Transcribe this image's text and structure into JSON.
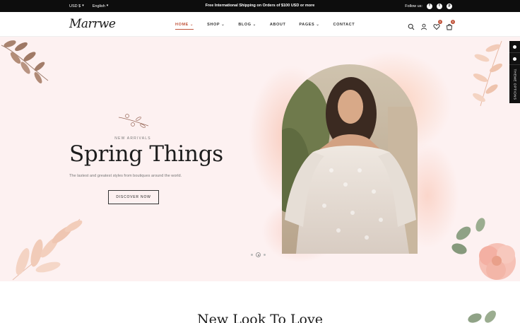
{
  "topbar": {
    "currency": "USD $",
    "language": "English",
    "promo": "Free International Shipping on Orders of $100 USD or more",
    "follow_label": "Follow us:",
    "social": [
      {
        "icon": "facebook-icon",
        "glyph": "f"
      },
      {
        "icon": "twitter-icon",
        "glyph": "t"
      },
      {
        "icon": "pinterest-icon",
        "glyph": "p"
      }
    ]
  },
  "header": {
    "logo": "Marrwe",
    "nav": [
      {
        "label": "HOME",
        "has_dropdown": true,
        "active": true
      },
      {
        "label": "SHOP",
        "has_dropdown": true
      },
      {
        "label": "BLOG",
        "has_dropdown": true
      },
      {
        "label": "ABOUT",
        "has_dropdown": false
      },
      {
        "label": "PAGES",
        "has_dropdown": true
      },
      {
        "label": "CONTACT",
        "has_dropdown": false
      }
    ],
    "wishlist_count": "0",
    "cart_count": "0",
    "accent": "#c0533a"
  },
  "hero": {
    "subtitle": "NEW ARRIVALS",
    "title": "Spring Things",
    "description": "The lastest and greatest styles from boutiques around the world.",
    "cta": "DISCOVER NOW",
    "slide_count": 3,
    "active_slide": 2,
    "background": "#fdf1f1"
  },
  "side_panel": {
    "label": "THEME OPTIONS"
  },
  "section": {
    "title": "New Look To Love"
  }
}
